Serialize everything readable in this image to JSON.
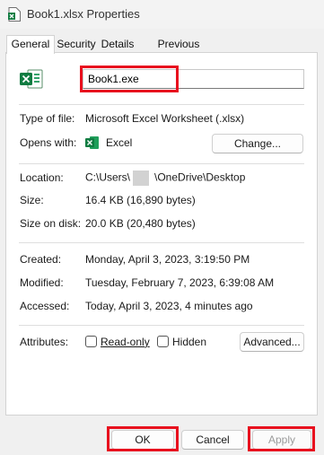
{
  "window": {
    "title": "Book1.xlsx Properties"
  },
  "tabs": [
    {
      "label": "General",
      "active": true
    },
    {
      "label": "Security"
    },
    {
      "label": "Details"
    },
    {
      "label": "Previous Versions"
    }
  ],
  "general": {
    "file_name": "Book1.exe",
    "type_of_file": {
      "label": "Type of file:",
      "value": "Microsoft Excel Worksheet (.xlsx)"
    },
    "opens_with": {
      "label": "Opens with:",
      "app": "Excel",
      "change_button": "Change..."
    },
    "location": {
      "label": "Location:",
      "prefix": "C:\\Users\\",
      "suffix": "\\OneDrive\\Desktop"
    },
    "size": {
      "label": "Size:",
      "value": "16.4 KB (16,890 bytes)"
    },
    "size_on_disk": {
      "label": "Size on disk:",
      "value": "20.0 KB (20,480 bytes)"
    },
    "created": {
      "label": "Created:",
      "value": "Monday, April 3, 2023, 3:19:50 PM"
    },
    "modified": {
      "label": "Modified:",
      "value": "Tuesday, February 7, 2023, 6:39:08 AM"
    },
    "accessed": {
      "label": "Accessed:",
      "value": "Today, April 3, 2023, 4 minutes ago"
    },
    "attributes": {
      "label": "Attributes:",
      "read_only": {
        "label": "Read-only",
        "checked": false
      },
      "hidden": {
        "label": "Hidden",
        "checked": false
      },
      "advanced_button": "Advanced..."
    }
  },
  "footer": {
    "ok": "OK",
    "cancel": "Cancel",
    "apply": "Apply"
  },
  "colors": {
    "highlight": "#e8101e",
    "excel_green": "#107c41"
  },
  "icons": {
    "app": "excel-file-icon",
    "opens_with": "excel-app-icon"
  }
}
